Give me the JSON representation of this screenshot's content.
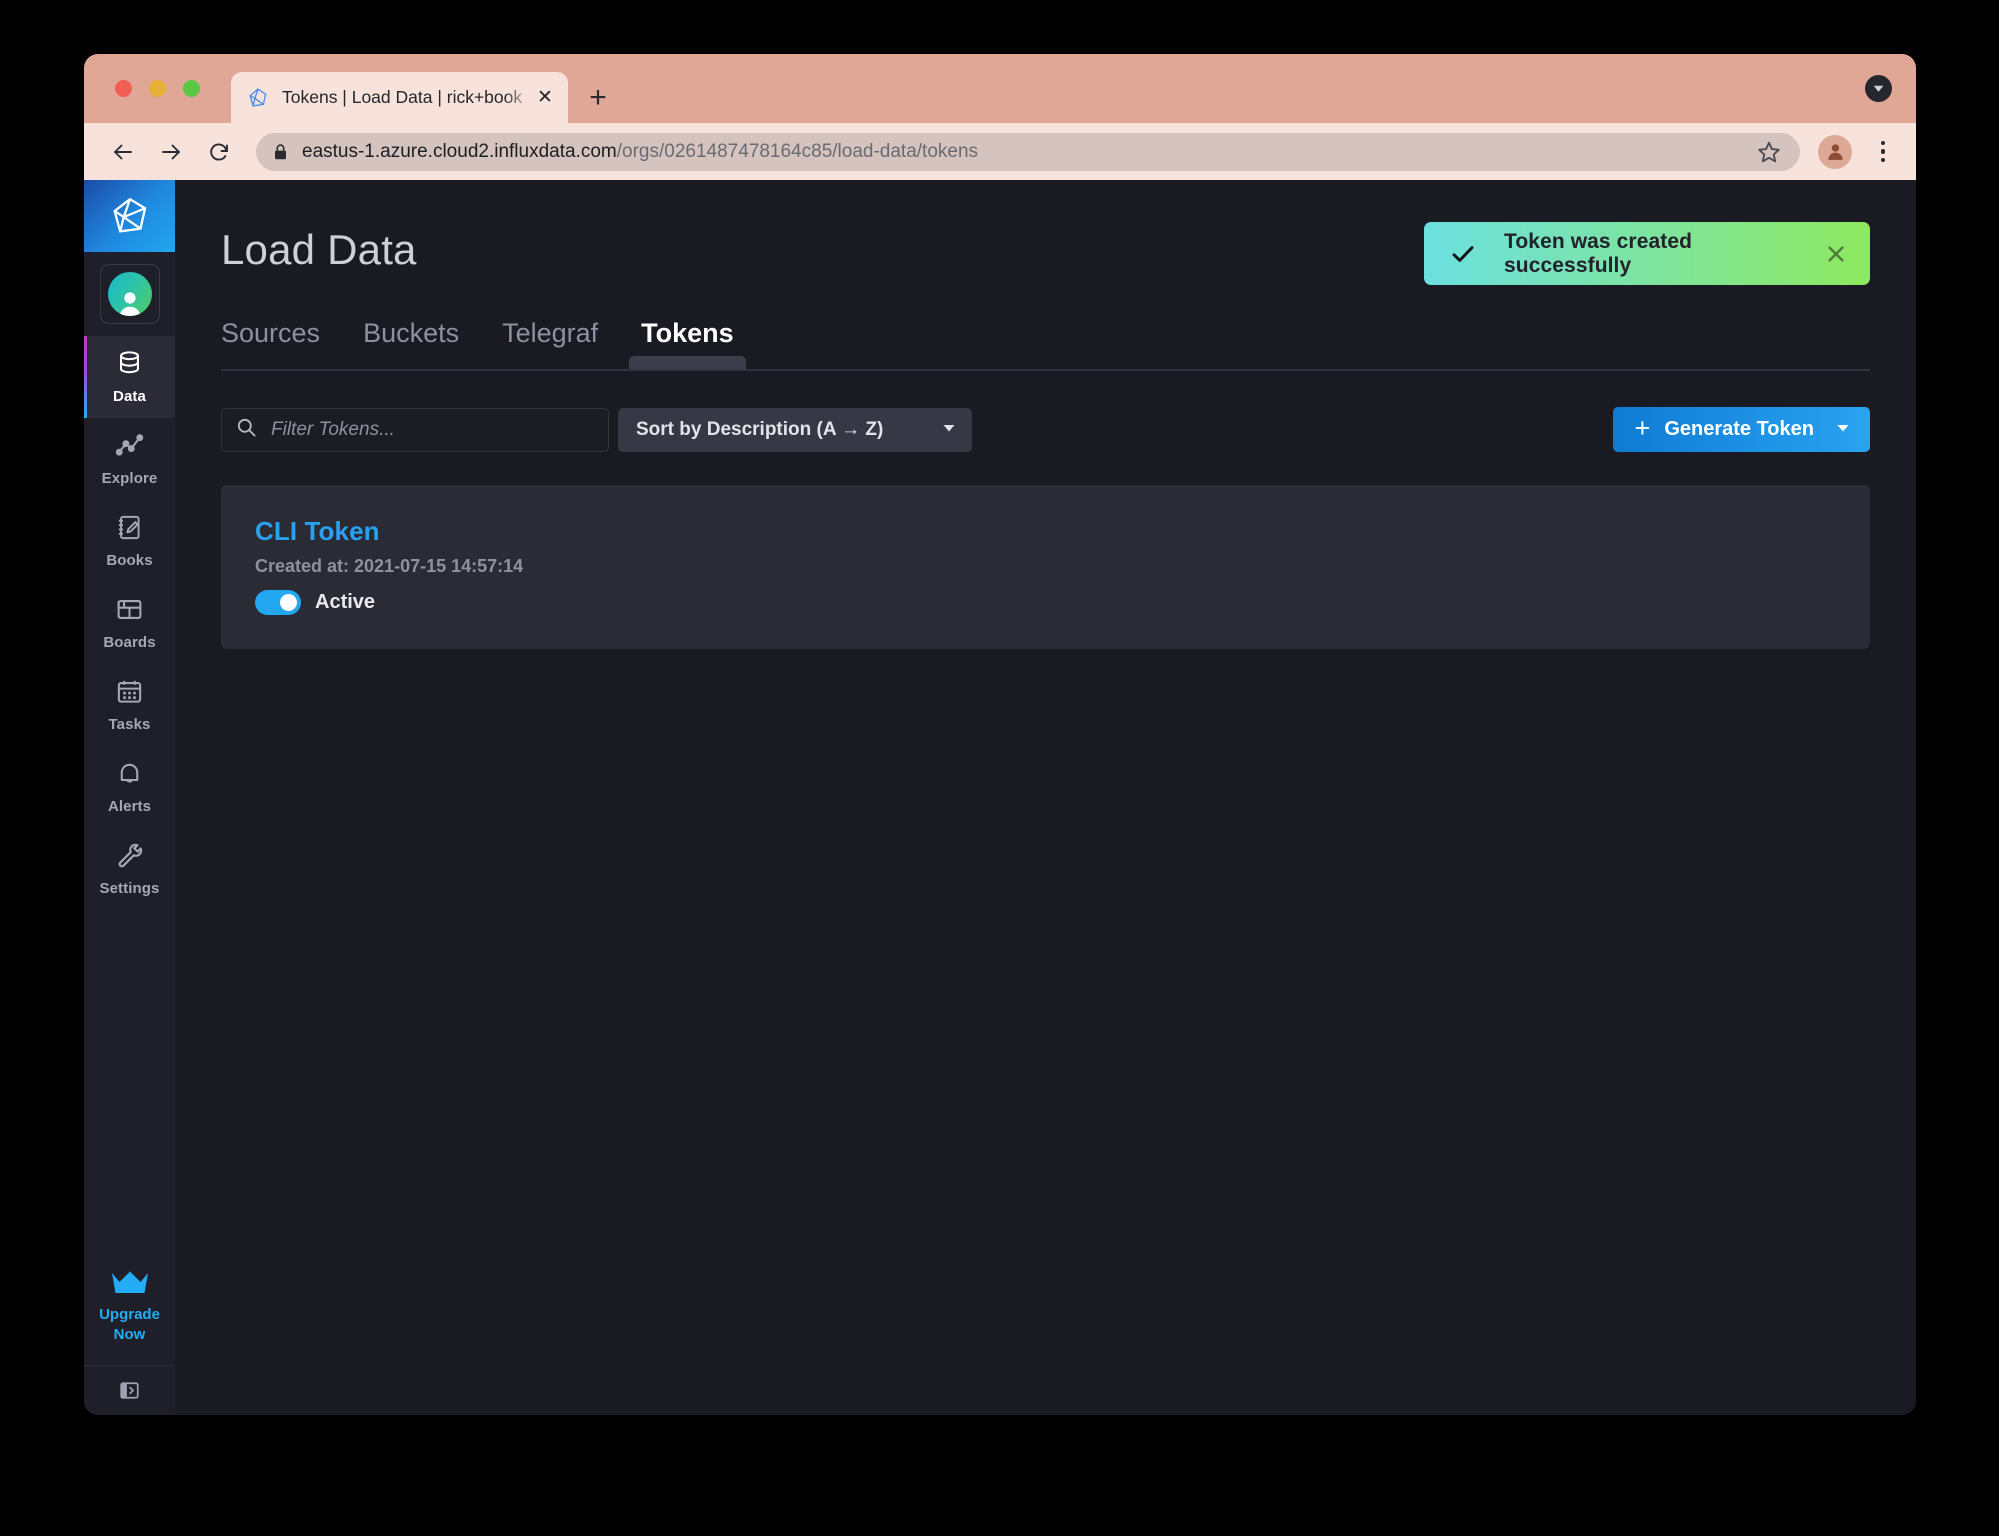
{
  "browser": {
    "tab": {
      "title": "Tokens | Load Data | rick+book",
      "favicon": "influxdb-logo-icon",
      "close_label": "✕"
    },
    "new_tab_label": "+",
    "toolbar": {
      "back_icon": "arrow-left-icon",
      "forward_icon": "arrow-right-icon",
      "reload_icon": "reload-icon",
      "lock_icon": "lock-icon",
      "url_domain": "eastus-1.azure.cloud2.influxdata.com",
      "url_path": "/orgs/0261487478164c85/load-data/tokens",
      "star_icon": "star-icon",
      "profile_icon": "profile-avatar-icon",
      "menu_icon": "kebab-menu-icon"
    },
    "tablist_icon": "tab-search-chevron-icon",
    "chrome_color": "#e0a796",
    "toolbar_color": "#f7e3dc"
  },
  "sidebar": {
    "logo_icon": "influxdb-logo-icon",
    "user_avatar_icon": "user-avatar-icon",
    "items": [
      {
        "label": "Data",
        "icon": "database-icon",
        "active": true
      },
      {
        "label": "Explore",
        "icon": "line-graph-icon",
        "active": false
      },
      {
        "label": "Books",
        "icon": "notebook-pencil-icon",
        "active": false
      },
      {
        "label": "Boards",
        "icon": "dashboard-grid-icon",
        "active": false
      },
      {
        "label": "Tasks",
        "icon": "calendar-icon",
        "active": false
      },
      {
        "label": "Alerts",
        "icon": "bell-icon",
        "active": false
      },
      {
        "label": "Settings",
        "icon": "wrench-icon",
        "active": false
      }
    ],
    "upgrade": {
      "icon": "crown-icon",
      "line1": "Upgrade",
      "line2": "Now",
      "color": "#22adf6"
    },
    "expand_icon": "expand-sidebar-icon",
    "active_accent": "#22adf6"
  },
  "header": {
    "title": "Load Data"
  },
  "notification": {
    "icon": "checkmark-icon",
    "message": "Token was created successfully",
    "close_icon": "close-icon",
    "gradient_from": "#6ce0e0",
    "gradient_to": "#8ee85f"
  },
  "tabs": [
    {
      "label": "Sources",
      "active": false
    },
    {
      "label": "Buckets",
      "active": false
    },
    {
      "label": "Telegraf",
      "active": false
    },
    {
      "label": "Tokens",
      "active": true
    }
  ],
  "controls": {
    "filter": {
      "icon": "search-icon",
      "value": "",
      "placeholder": "Filter Tokens..."
    },
    "sort": {
      "selected": "Sort by Description (A → Z)",
      "caret_icon": "chevron-down-icon"
    },
    "generate": {
      "plus_icon": "plus-icon",
      "label": "Generate Token",
      "caret_icon": "chevron-down-icon",
      "color": "#22a7f0"
    }
  },
  "tokens": [
    {
      "name": "CLI Token",
      "created": "Created at: 2021-07-15 14:57:14",
      "status_label": "Active",
      "active": true
    }
  ]
}
